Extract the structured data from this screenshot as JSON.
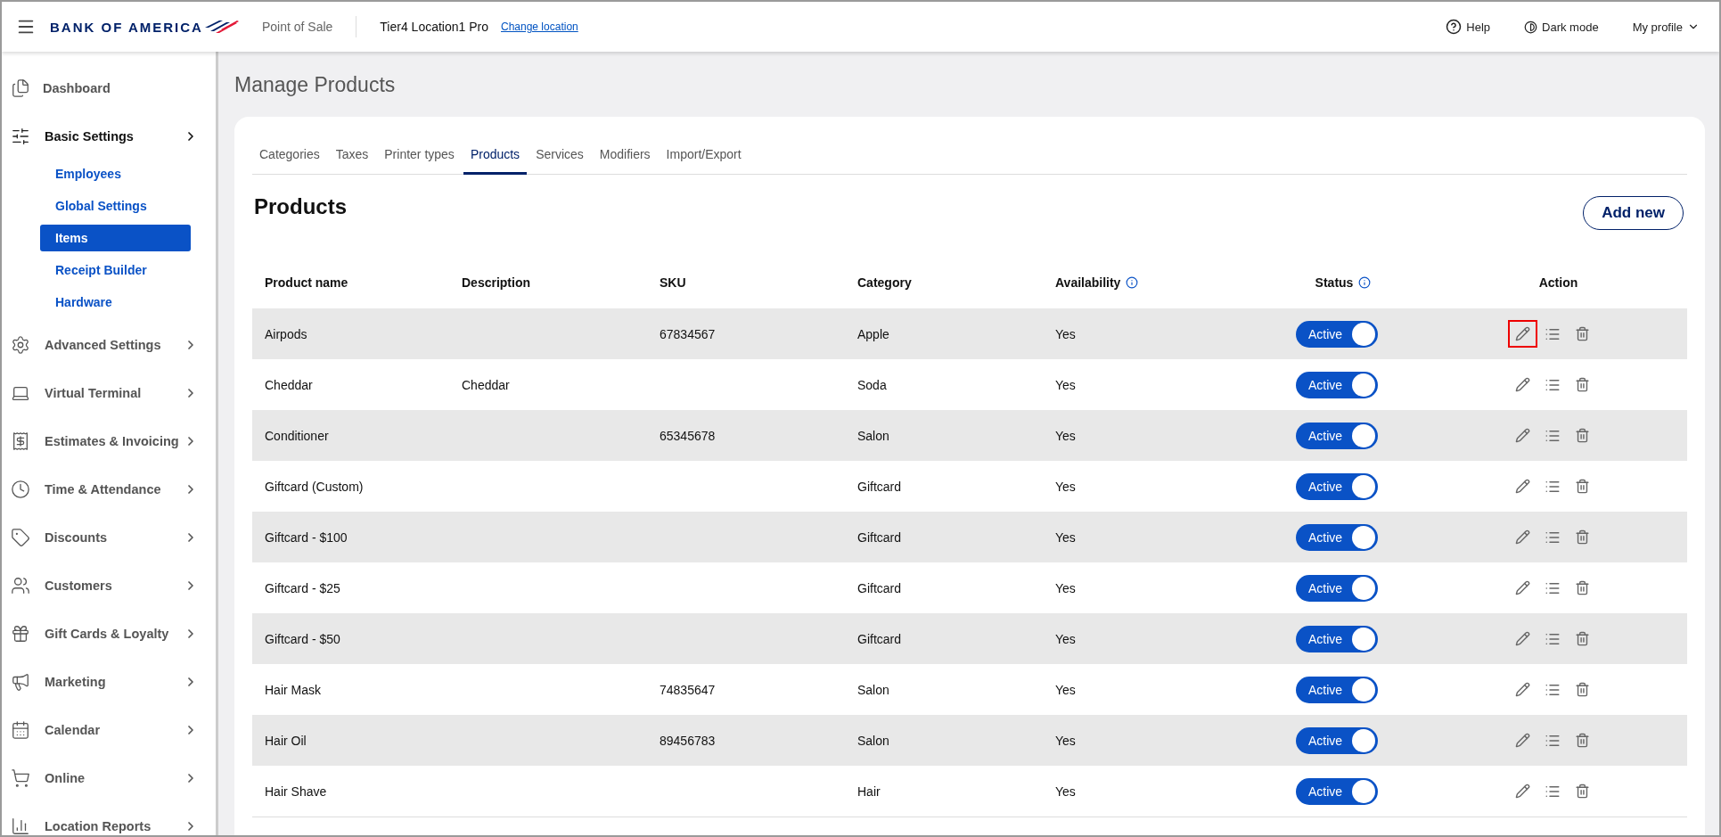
{
  "header": {
    "brand": "BANK OF AMERICA",
    "app": "Point of Sale",
    "location": "Tier4 Location1 Pro",
    "change_location": "Change location",
    "help": "Help",
    "dark_mode": "Dark mode",
    "profile": "My profile"
  },
  "sidebar": {
    "items": [
      {
        "label": "Dashboard",
        "expanded": false,
        "has_arrow": false
      },
      {
        "label": "Basic Settings",
        "expanded": true,
        "has_arrow": true,
        "children": [
          {
            "label": "Employees",
            "selected": false
          },
          {
            "label": "Global Settings",
            "selected": false
          },
          {
            "label": "Items",
            "selected": true
          },
          {
            "label": "Receipt Builder",
            "selected": false
          },
          {
            "label": "Hardware",
            "selected": false
          }
        ]
      },
      {
        "label": "Advanced Settings",
        "expanded": false,
        "has_arrow": true
      },
      {
        "label": "Virtual Terminal",
        "expanded": false,
        "has_arrow": true
      },
      {
        "label": "Estimates & Invoicing",
        "expanded": false,
        "has_arrow": true
      },
      {
        "label": "Time & Attendance",
        "expanded": false,
        "has_arrow": true
      },
      {
        "label": "Discounts",
        "expanded": false,
        "has_arrow": true
      },
      {
        "label": "Customers",
        "expanded": false,
        "has_arrow": true
      },
      {
        "label": "Gift Cards & Loyalty",
        "expanded": false,
        "has_arrow": true
      },
      {
        "label": "Marketing",
        "expanded": false,
        "has_arrow": true
      },
      {
        "label": "Calendar",
        "expanded": false,
        "has_arrow": true
      },
      {
        "label": "Online",
        "expanded": false,
        "has_arrow": true
      },
      {
        "label": "Location Reports",
        "expanded": false,
        "has_arrow": true
      }
    ]
  },
  "page_title": "Manage Products",
  "tabs": [
    {
      "label": "Categories",
      "selected": false
    },
    {
      "label": "Taxes",
      "selected": false
    },
    {
      "label": "Printer types",
      "selected": false
    },
    {
      "label": "Products",
      "selected": true
    },
    {
      "label": "Services",
      "selected": false
    },
    {
      "label": "Modifiers",
      "selected": false
    },
    {
      "label": "Import/Export",
      "selected": false
    }
  ],
  "section_title": "Products",
  "add_button": "Add new",
  "table": {
    "columns": [
      {
        "label": "Product name",
        "info": false
      },
      {
        "label": "Description",
        "info": false
      },
      {
        "label": "SKU",
        "info": false
      },
      {
        "label": "Category",
        "info": false
      },
      {
        "label": "Availability",
        "info": true
      },
      {
        "label": "Status",
        "info": true
      },
      {
        "label": "Action",
        "info": false
      }
    ],
    "rows": [
      {
        "name": "Airpods",
        "description": "",
        "sku": "67834567",
        "category": "Apple",
        "availability": "Yes",
        "status": "Active",
        "on": true,
        "edit_highlighted": true
      },
      {
        "name": "Cheddar",
        "description": "Cheddar",
        "sku": "",
        "category": "Soda",
        "availability": "Yes",
        "status": "Active",
        "on": true,
        "edit_highlighted": false
      },
      {
        "name": "Conditioner",
        "description": "",
        "sku": "65345678",
        "category": "Salon",
        "availability": "Yes",
        "status": "Active",
        "on": true,
        "edit_highlighted": false
      },
      {
        "name": "Giftcard (Custom)",
        "description": "",
        "sku": "",
        "category": "Giftcard",
        "availability": "Yes",
        "status": "Active",
        "on": true,
        "edit_highlighted": false
      },
      {
        "name": "Giftcard - $100",
        "description": "",
        "sku": "",
        "category": "Giftcard",
        "availability": "Yes",
        "status": "Active",
        "on": true,
        "edit_highlighted": false
      },
      {
        "name": "Giftcard - $25",
        "description": "",
        "sku": "",
        "category": "Giftcard",
        "availability": "Yes",
        "status": "Active",
        "on": true,
        "edit_highlighted": false
      },
      {
        "name": "Giftcard - $50",
        "description": "",
        "sku": "",
        "category": "Giftcard",
        "availability": "Yes",
        "status": "Active",
        "on": true,
        "edit_highlighted": false
      },
      {
        "name": "Hair Mask",
        "description": "",
        "sku": "74835647",
        "category": "Salon",
        "availability": "Yes",
        "status": "Active",
        "on": true,
        "edit_highlighted": false
      },
      {
        "name": "Hair Oil",
        "description": "",
        "sku": "89456783",
        "category": "Salon",
        "availability": "Yes",
        "status": "Active",
        "on": true,
        "edit_highlighted": false
      },
      {
        "name": "Hair Shave",
        "description": "",
        "sku": "",
        "category": "Hair",
        "availability": "Yes",
        "status": "Active",
        "on": true,
        "edit_highlighted": false
      }
    ]
  }
}
